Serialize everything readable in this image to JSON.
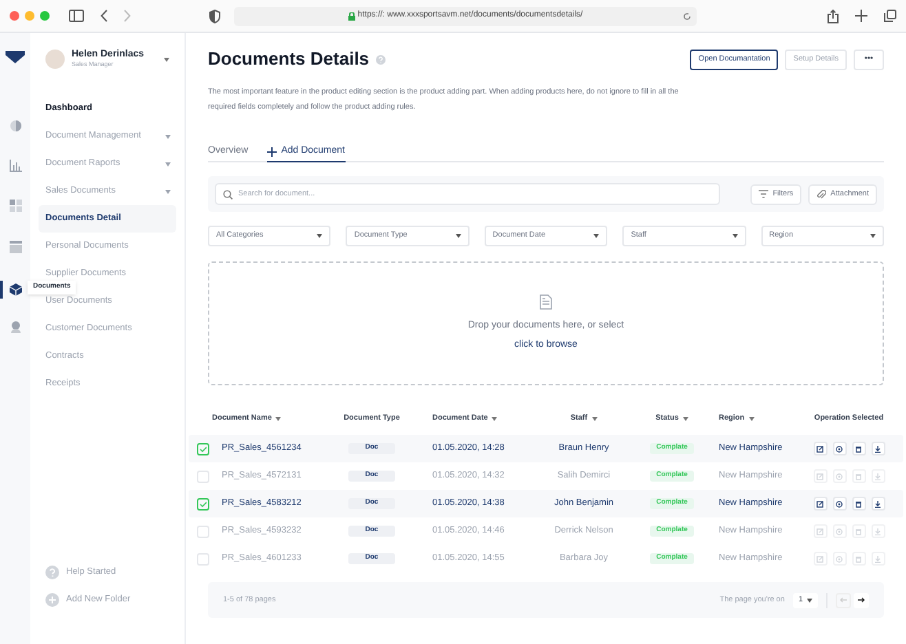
{
  "browser": {
    "url": "https://: www.xxxsportsavm.net/documents/documentsdetails/"
  },
  "rail": {
    "items": [
      {
        "kind": "contrast",
        "selected": false
      },
      {
        "kind": "chart",
        "selected": false
      },
      {
        "kind": "grid",
        "selected": false
      },
      {
        "kind": "table",
        "selected": false
      },
      {
        "kind": "box",
        "selected": true
      },
      {
        "kind": "person",
        "selected": false
      }
    ],
    "tooltip": "Documents"
  },
  "user": {
    "name": "Helen Derinlacs",
    "role": "Sales Manager"
  },
  "sidebar": {
    "items": [
      {
        "label": "Dashboard",
        "kind": "heading",
        "expandable": false,
        "selected": false
      },
      {
        "label": "Document Management",
        "kind": "item",
        "expandable": true,
        "selected": false
      },
      {
        "label": "Document Raports",
        "kind": "item",
        "expandable": true,
        "selected": false
      },
      {
        "label": "Sales Documents",
        "kind": "item",
        "expandable": true,
        "selected": false
      },
      {
        "label": "Documents Detail",
        "kind": "item",
        "expandable": false,
        "selected": true
      },
      {
        "label": "Personal Documents",
        "kind": "item",
        "expandable": false,
        "selected": false
      },
      {
        "label": "Supplier Documents",
        "kind": "item",
        "expandable": false,
        "selected": false
      },
      {
        "label": "User Documents",
        "kind": "item",
        "expandable": false,
        "selected": false
      },
      {
        "label": "Customer Documents",
        "kind": "item",
        "expandable": false,
        "selected": false
      },
      {
        "label": "Contracts",
        "kind": "item",
        "expandable": false,
        "selected": false
      },
      {
        "label": "Receipts",
        "kind": "item",
        "expandable": false,
        "selected": false
      }
    ],
    "footer": [
      {
        "label": "Help Started",
        "kind": "help"
      },
      {
        "label": "Add New Folder",
        "kind": "add"
      }
    ]
  },
  "page": {
    "title": "Documents Details",
    "description": "The most important feature in the product editing section is the product adding part. When adding products here, do not ignore to fill in all the required fields completely and follow the product adding rules.",
    "buttons": [
      {
        "label": "Open Documantation",
        "kind": "primary"
      },
      {
        "label": "Setup Details",
        "kind": "secondary"
      },
      {
        "label": "•••",
        "kind": "more"
      }
    ]
  },
  "tabs": [
    {
      "label": "Overview",
      "kind": "plain",
      "selected": false
    },
    {
      "label": "Add Document",
      "kind": "add",
      "selected": true
    }
  ],
  "search": {
    "placeholder": "Search for document..."
  },
  "tools": [
    {
      "label": "Filters",
      "kind": "filter"
    },
    {
      "label": "Attachment",
      "kind": "attachment"
    }
  ],
  "filters": [
    "All Categories",
    "Document Type",
    "Document Date",
    "Staff",
    "Region"
  ],
  "dropzone": {
    "text": "Drop your documents here, or select",
    "link": "click to browse"
  },
  "table": {
    "columns": [
      {
        "label": "Document Name",
        "sortable": true
      },
      {
        "label": "Document Type",
        "sortable": false
      },
      {
        "label": "Document Date",
        "sortable": true
      },
      {
        "label": "Staff",
        "sortable": true
      },
      {
        "label": "Status",
        "sortable": true
      },
      {
        "label": "Region",
        "sortable": true
      },
      {
        "label": "Operation Selected",
        "sortable": false
      }
    ],
    "rows": [
      {
        "selected": true,
        "name": "PR_Sales_4561234",
        "type": "Doc",
        "date": "01.05.2020, 14:28",
        "staff": "Braun Henry",
        "status": "Complate",
        "region": "New Hampshire"
      },
      {
        "selected": false,
        "name": "PR_Sales_4572131",
        "type": "Doc",
        "date": "01.05.2020, 14:32",
        "staff": "Salih Demirci",
        "status": "Complate",
        "region": "New Hampshire"
      },
      {
        "selected": true,
        "name": "PR_Sales_4583212",
        "type": "Doc",
        "date": "01.05.2020, 14:38",
        "staff": "John Benjamin",
        "status": "Complate",
        "region": "New Hampshire"
      },
      {
        "selected": false,
        "name": "PR_Sales_4593232",
        "type": "Doc",
        "date": "01.05.2020, 14:46",
        "staff": "Derrick Nelson",
        "status": "Complate",
        "region": "New Hampshire"
      },
      {
        "selected": false,
        "name": "PR_Sales_4601233",
        "type": "Doc",
        "date": "01.05.2020, 14:55",
        "staff": "Barbara Joy",
        "status": "Complate",
        "region": "New Hampshire"
      }
    ]
  },
  "pagination": {
    "summary": "1-5 of 78 pages",
    "page_label": "The page you're on",
    "page": "1"
  }
}
